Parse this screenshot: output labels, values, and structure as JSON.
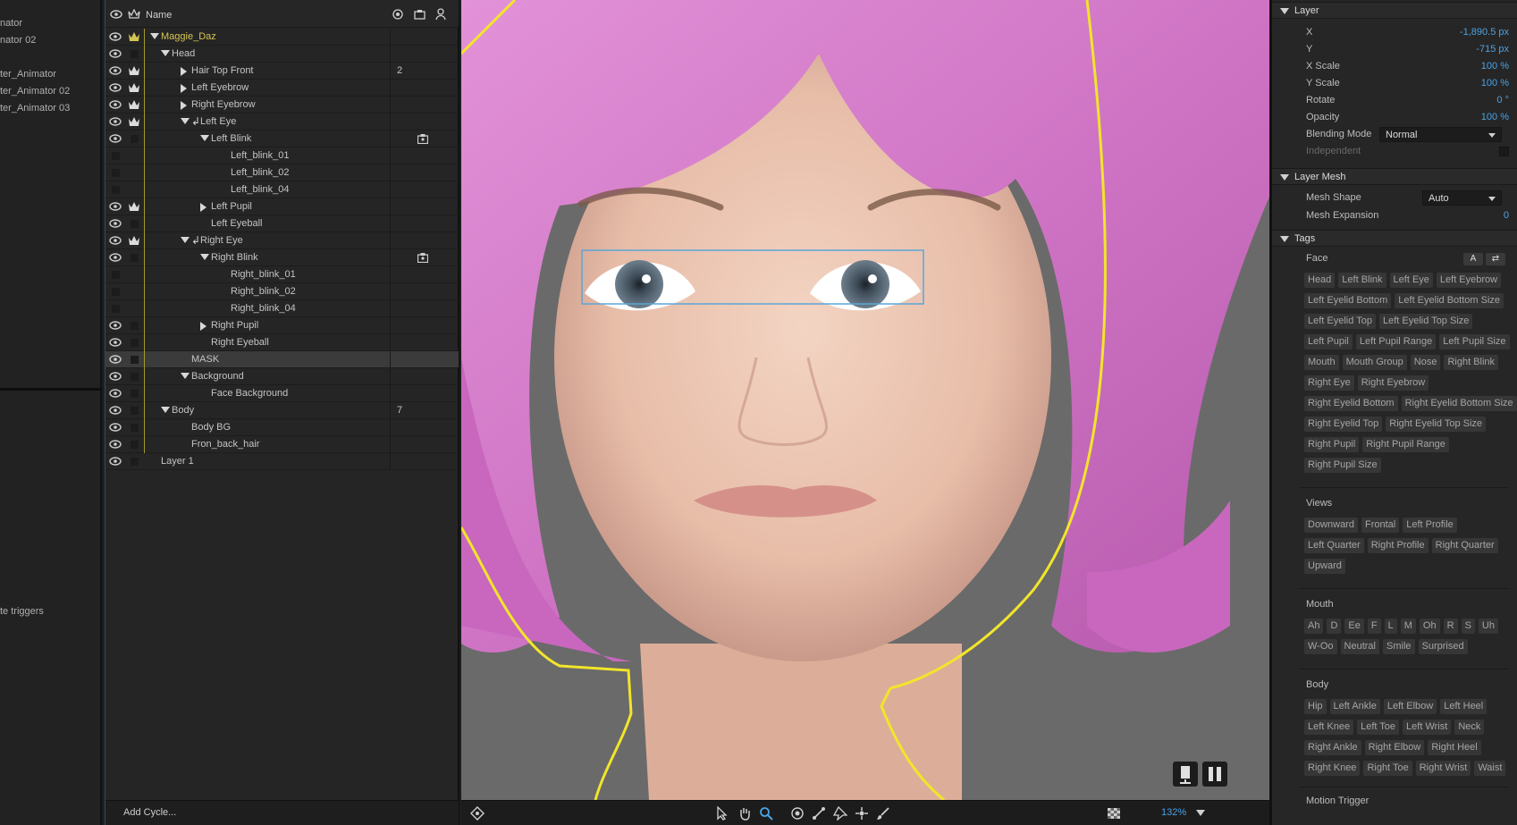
{
  "left_panel": {
    "items": [
      "nator",
      "nator 02",
      "ter_Animator",
      "ter_Animator 02",
      "ter_Animator 03"
    ],
    "trigger_label": "te triggers"
  },
  "tree": {
    "header": {
      "name_col": "Name"
    },
    "rows": [
      {
        "label": "Maggie_Daz",
        "indent": 0,
        "arrow": "down",
        "eye": true,
        "crown": true,
        "gold": true
      },
      {
        "label": "Head",
        "indent": 1,
        "arrow": "down",
        "eye": true,
        "crown": false
      },
      {
        "label": "Hair Top Front",
        "indent": 2,
        "arrow": "right",
        "eye": true,
        "crown": true,
        "count": "2"
      },
      {
        "label": "Left Eyebrow",
        "indent": 2,
        "arrow": "right",
        "eye": true,
        "crown": true
      },
      {
        "label": "Right Eyebrow",
        "indent": 2,
        "arrow": "right",
        "eye": true,
        "crown": true
      },
      {
        "label": "Left Eye",
        "indent": 2,
        "arrow": "down",
        "eye": true,
        "crown": true,
        "hook": true
      },
      {
        "label": "Left Blink",
        "indent": 3,
        "arrow": "down",
        "eye": true,
        "crown": false,
        "tagicon": true
      },
      {
        "label": "Left_blink_01",
        "indent": 4,
        "arrow": "",
        "eye": false,
        "crown": false
      },
      {
        "label": "Left_blink_02",
        "indent": 4,
        "arrow": "",
        "eye": false,
        "crown": false
      },
      {
        "label": "Left_blink_04",
        "indent": 4,
        "arrow": "",
        "eye": false,
        "crown": false
      },
      {
        "label": "Left Pupil",
        "indent": 3,
        "arrow": "right",
        "eye": true,
        "crown": true
      },
      {
        "label": "Left Eyeball",
        "indent": 3,
        "arrow": "",
        "eye": true,
        "crown": false
      },
      {
        "label": "Right Eye",
        "indent": 2,
        "arrow": "down",
        "eye": true,
        "crown": true,
        "hook": true
      },
      {
        "label": "Right Blink",
        "indent": 3,
        "arrow": "down",
        "eye": true,
        "crown": false,
        "tagicon": true
      },
      {
        "label": "Right_blink_01",
        "indent": 4,
        "arrow": "",
        "eye": false,
        "crown": false
      },
      {
        "label": "Right_blink_02",
        "indent": 4,
        "arrow": "",
        "eye": false,
        "crown": false
      },
      {
        "label": "Right_blink_04",
        "indent": 4,
        "arrow": "",
        "eye": false,
        "crown": false
      },
      {
        "label": "Right Pupil",
        "indent": 3,
        "arrow": "right",
        "eye": true,
        "crown": false
      },
      {
        "label": "Right Eyeball",
        "indent": 3,
        "arrow": "",
        "eye": true,
        "crown": false
      },
      {
        "label": "MASK",
        "indent": 2,
        "arrow": "",
        "eye": true,
        "crown": false,
        "selected": true
      },
      {
        "label": "Background",
        "indent": 2,
        "arrow": "down",
        "eye": true,
        "crown": false
      },
      {
        "label": "Face Background",
        "indent": 3,
        "arrow": "",
        "eye": true,
        "crown": false
      },
      {
        "label": "Body",
        "indent": 1,
        "arrow": "down",
        "eye": true,
        "crown": false,
        "count": "7"
      },
      {
        "label": "Body BG",
        "indent": 2,
        "arrow": "",
        "eye": true,
        "crown": false
      },
      {
        "label": "Fron_back_hair",
        "indent": 2,
        "arrow": "",
        "eye": true,
        "crown": false
      },
      {
        "label": "Layer 1",
        "indent": 0,
        "arrow": "",
        "eye": true,
        "crown": false,
        "novline": true
      }
    ],
    "add_cycle": "Add Cycle..."
  },
  "viewport": {
    "zoom": "132%",
    "hair_color": "#d680cc",
    "outline_color": "#f2e52a",
    "selection_color": "#5aa6d8"
  },
  "props": {
    "layer": {
      "title": "Layer",
      "rows": [
        {
          "label": "X",
          "value": "-1,890.5 px"
        },
        {
          "label": "Y",
          "value": "-715 px"
        },
        {
          "label": "X Scale",
          "value": "100 %"
        },
        {
          "label": "Y Scale",
          "value": "100 %"
        },
        {
          "label": "Rotate",
          "value": "0 °"
        },
        {
          "label": "Opacity",
          "value": "100 %"
        }
      ],
      "blending_label": "Blending Mode",
      "blending_value": "Normal",
      "independent_label": "Independent"
    },
    "mesh": {
      "title": "Layer Mesh",
      "shape_label": "Mesh Shape",
      "shape_value": "Auto",
      "expansion_label": "Mesh Expansion",
      "expansion_value": "0"
    },
    "tags": {
      "title": "Tags",
      "face_label": "Face",
      "face_btn_a": "A",
      "face_rows": [
        [
          "Head",
          "Left Blink",
          "Left Eye",
          "Left Eyebrow"
        ],
        [
          "Left Eyelid Bottom",
          "Left Eyelid Bottom Size"
        ],
        [
          "Left Eyelid Top",
          "Left Eyelid Top Size"
        ],
        [
          "Left Pupil",
          "Left Pupil Range",
          "Left Pupil Size"
        ],
        [
          "Mouth",
          "Mouth Group",
          "Nose",
          "Right Blink"
        ],
        [
          "Right Eye",
          "Right Eyebrow"
        ],
        [
          "Right Eyelid Bottom",
          "Right Eyelid Bottom Size"
        ],
        [
          "Right Eyelid Top",
          "Right Eyelid Top Size"
        ],
        [
          "Right Pupil",
          "Right Pupil Range"
        ],
        [
          "Right Pupil Size"
        ]
      ],
      "views_label": "Views",
      "views_rows": [
        [
          "Downward",
          "Frontal",
          "Left Profile"
        ],
        [
          "Left Quarter",
          "Right Profile",
          "Right Quarter"
        ],
        [
          "Upward"
        ]
      ],
      "mouth_label": "Mouth",
      "mouth_rows": [
        [
          "Ah",
          "D",
          "Ee",
          "F",
          "L",
          "M",
          "Oh",
          "R",
          "S",
          "Uh"
        ],
        [
          "W-Oo",
          "Neutral",
          "Smile",
          "Surprised"
        ]
      ],
      "body_label": "Body",
      "body_rows": [
        [
          "Hip",
          "Left Ankle",
          "Left Elbow",
          "Left Heel"
        ],
        [
          "Left Knee",
          "Left Toe",
          "Left Wrist",
          "Neck"
        ],
        [
          "Right Ankle",
          "Right Elbow",
          "Right Heel"
        ],
        [
          "Right Knee",
          "Right Toe",
          "Right Wrist",
          "Waist"
        ]
      ],
      "motion_label": "Motion Trigger"
    }
  }
}
